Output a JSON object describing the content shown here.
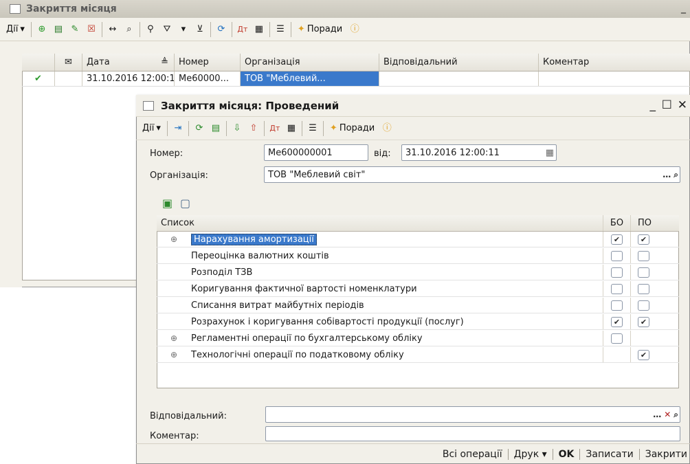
{
  "background_window": {
    "title": "Закриття місяця",
    "toolbar": {
      "actions_label": "Дії",
      "tips_label": "Поради"
    },
    "columns": [
      "Дата",
      "Номер",
      "Організація",
      "Відповідальний",
      "Коментар"
    ],
    "rows": [
      {
        "date": "31.10.2016 12:00:11",
        "number": "Ме60000...",
        "organization": "ТОВ \"Меблевий...",
        "responsible": "",
        "comment": ""
      }
    ]
  },
  "dialog": {
    "title": "Закриття місяця: Проведений",
    "toolbar": {
      "actions_label": "Дії",
      "tips_label": "Поради"
    },
    "number_label": "Номер:",
    "number_value": "Ме600000001",
    "from_label": "від:",
    "date_value": "31.10.2016 12:00:11",
    "organization_label": "Організація:",
    "organization_value": "ТОВ \"Меблевий світ\"",
    "table": {
      "col_list": "Список",
      "col_bo": "БО",
      "col_po": "ПО",
      "rows": [
        {
          "name": "Нарахування амортизації",
          "expandable": true,
          "bo": true,
          "po": true,
          "selected": true
        },
        {
          "name": "Переоцінка валютних коштів",
          "expandable": false,
          "bo": false,
          "po": false
        },
        {
          "name": "Розподіл ТЗВ",
          "expandable": false,
          "bo": false,
          "po": false
        },
        {
          "name": "Коригування фактичної вартості номенклатури",
          "expandable": false,
          "bo": false,
          "po": false
        },
        {
          "name": "Списання витрат майбутніх періодів",
          "expandable": false,
          "bo": false,
          "po": false
        },
        {
          "name": "Розрахунок і коригування собівартості продукції (послуг)",
          "expandable": false,
          "bo": true,
          "po": true
        },
        {
          "name": "Регламентні операції по бухгалтерському обліку",
          "expandable": true,
          "bo": false,
          "po": null
        },
        {
          "name": "Технологічні операції по податковому обліку",
          "expandable": true,
          "bo": null,
          "po": true
        }
      ]
    },
    "responsible_label": "Відповідальний:",
    "responsible_value": "",
    "comment_label": "Коментар:",
    "comment_value": "",
    "footer": {
      "all_ops": "Всі операції",
      "print": "Друк",
      "ok": "OK",
      "save": "Записати",
      "close": "Закрити"
    }
  }
}
